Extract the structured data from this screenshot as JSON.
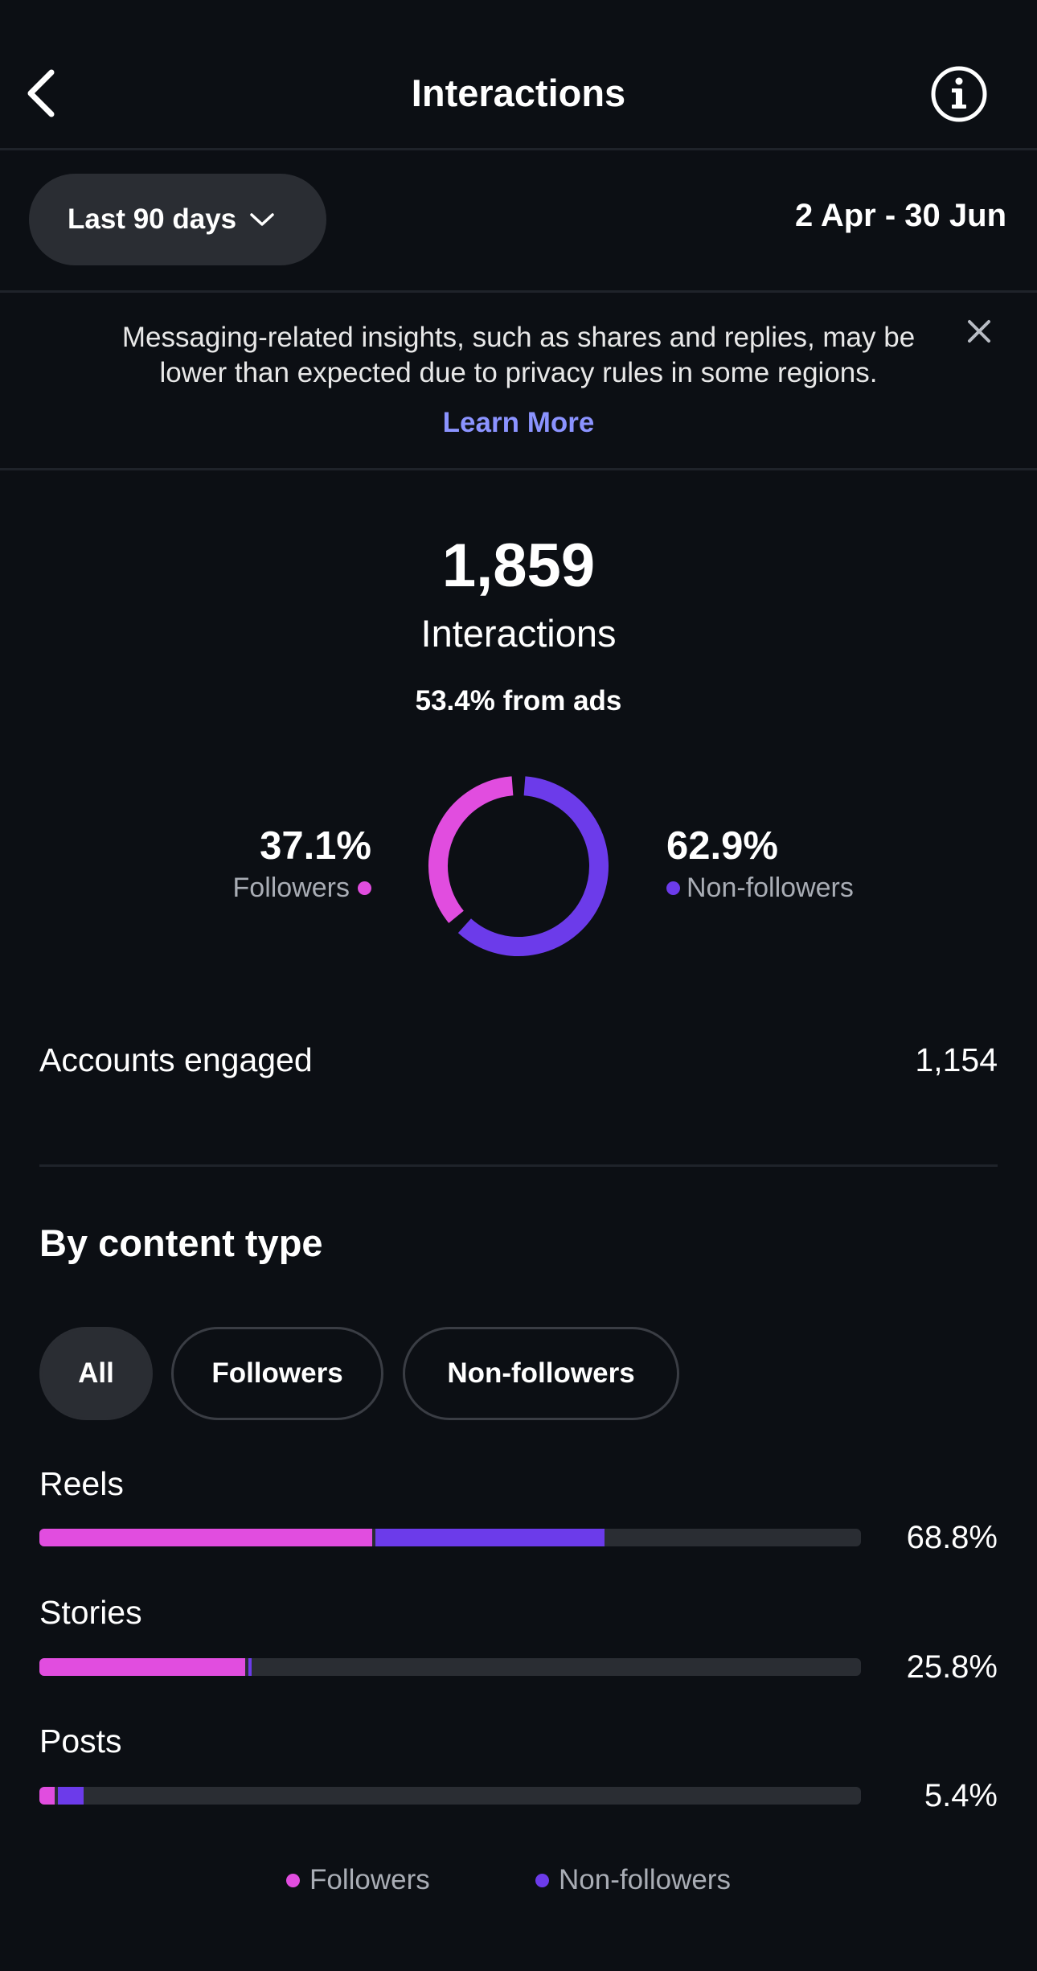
{
  "header": {
    "title": "Interactions",
    "back_icon": "chevron-left-icon",
    "info_icon": "info-icon"
  },
  "filter": {
    "range_label": "Last 90 days",
    "date_range": "2 Apr - 30 Jun"
  },
  "notice": {
    "text": "Messaging-related insights, such as shares and replies, may be lower than expected due to privacy rules in some regions.",
    "link": "Learn More"
  },
  "summary": {
    "total": "1,859",
    "label": "Interactions",
    "ads": "53.4% from ads",
    "followers_pct": "37.1%",
    "followers_label": "Followers",
    "nonfollowers_pct": "62.9%",
    "nonfollowers_label": "Non-followers",
    "followers_fraction": 0.371
  },
  "accounts": {
    "label": "Accounts engaged",
    "value": "1,154"
  },
  "content_type": {
    "title": "By content type",
    "chips": [
      "All",
      "Followers",
      "Non-followers"
    ],
    "rows": [
      {
        "label": "Reels",
        "value": "68.8%",
        "followers": 40.5,
        "nonfollowers": 28.3
      },
      {
        "label": "Stories",
        "value": "25.8%",
        "followers": 25.0,
        "nonfollowers": 0.8
      },
      {
        "label": "Posts",
        "value": "5.4%",
        "followers": 1.9,
        "nonfollowers": 3.5
      }
    ],
    "legend": [
      "Followers",
      "Non-followers"
    ]
  },
  "colors": {
    "followers": "#e14ddf",
    "nonfollowers": "#6c3bea",
    "link": "#8b93ff",
    "background": "#0c0f14"
  }
}
